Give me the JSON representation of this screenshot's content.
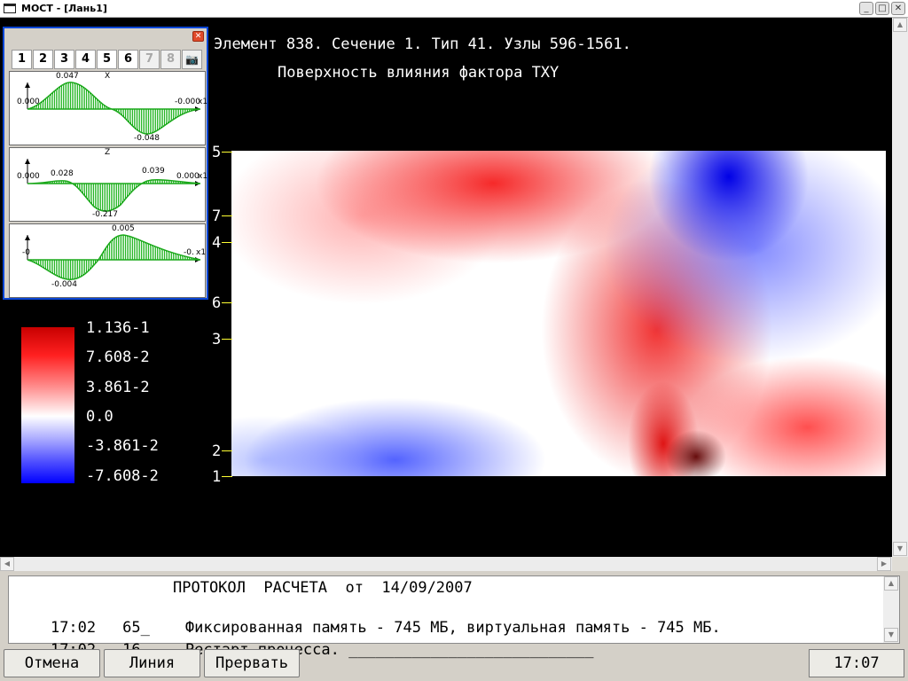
{
  "window": {
    "title": "МОСТ - [Лань1]",
    "buttons": {
      "minimize": "_",
      "maximize": "□",
      "close": "✕"
    }
  },
  "header": {
    "line1": "Элемент 838. Сечение 1. Тип 41. Узлы 596-1561.",
    "line2": "Поверхность влияния фактора TXY"
  },
  "plot": {
    "node_labels": [
      "5",
      "7",
      "4",
      "6",
      "3",
      "2",
      "1"
    ],
    "colors": {
      "positive": "#ff0000",
      "negative": "#0000ff",
      "zero": "#ffffff",
      "tick": "#ffff33"
    }
  },
  "legend": {
    "labels": [
      "1.136-1",
      "7.608-2",
      "3.861-2",
      "0.0",
      "-3.861-2",
      "-7.608-2"
    ]
  },
  "palette": {
    "close": "✕",
    "tabs": [
      {
        "label": "1",
        "enabled": true
      },
      {
        "label": "2",
        "enabled": true
      },
      {
        "label": "3",
        "enabled": true
      },
      {
        "label": "4",
        "enabled": true
      },
      {
        "label": "5",
        "enabled": true
      },
      {
        "label": "6",
        "enabled": true
      },
      {
        "label": "7",
        "enabled": false
      },
      {
        "label": "8",
        "enabled": false
      }
    ],
    "camera_icon": "📷",
    "graphs": [
      {
        "axis_label": "X",
        "left_value": "0.000",
        "right_value": "-0.000",
        "axis_name": "x1",
        "max_label": "0.047",
        "min_label": "-0.048"
      },
      {
        "axis_label": "Z",
        "left_value": "0.000",
        "right_value": "0.000",
        "axis_name": "x1",
        "max_label": "0.028",
        "max_label2": "0.039",
        "min_label": "-0.217"
      },
      {
        "axis_label": "",
        "left_value": "-0",
        "right_value": "-0.",
        "axis_name": "x1",
        "max_label": "0.005",
        "min_label": "-0.004"
      }
    ]
  },
  "protocol": {
    "title": "ПРОТОКОЛ  РАСЧЕТА  от  14/09/2007",
    "lines": [
      {
        "time": "17:02",
        "code": "65_",
        "text": "Фиксированная память - 745 МБ, виртуальная память - 745 МБ."
      },
      {
        "time": "17:02",
        "code": "16_",
        "text": "Рестарт процесса. ___________________________"
      }
    ]
  },
  "buttons": {
    "cancel": "Отмена",
    "line": "Линия",
    "interrupt": "Прервать"
  },
  "status": {
    "clock": "17:07"
  }
}
